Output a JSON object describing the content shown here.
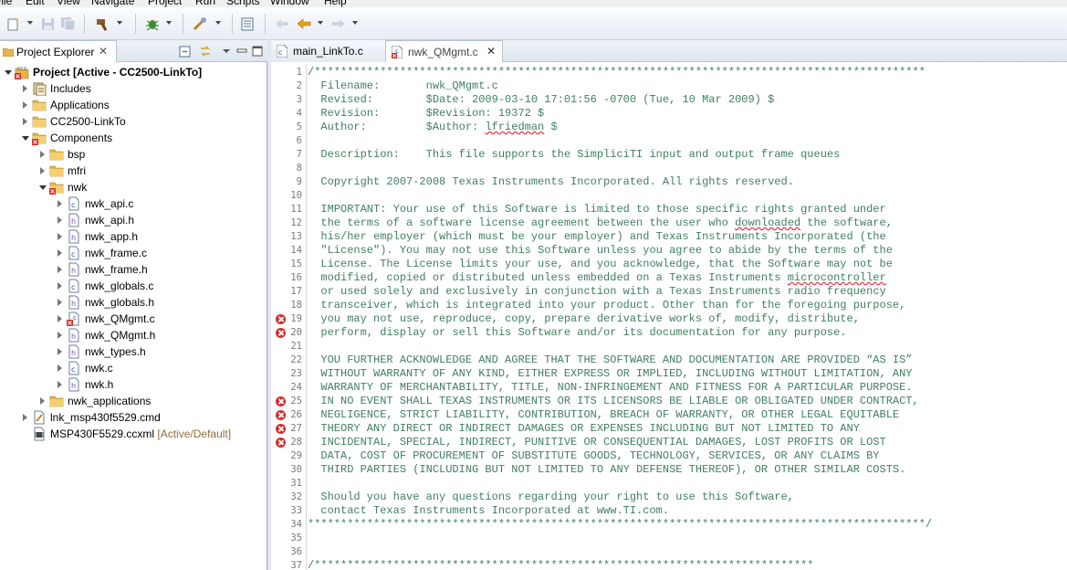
{
  "menubar": {
    "items": [
      "File",
      "Edit",
      "View",
      "Navigate",
      "Project",
      "Run",
      "Scripts",
      "Window",
      "Help"
    ]
  },
  "toolbar": {
    "buttons": [
      {
        "name": "new-icon"
      },
      {
        "name": "save-icon"
      },
      {
        "name": "save-all-icon"
      },
      {
        "name": "build-icon"
      },
      {
        "name": "debug-icon"
      },
      {
        "name": "tools-icon"
      },
      {
        "name": "view-icon"
      },
      {
        "name": "back-icon"
      },
      {
        "name": "forward-icon"
      }
    ]
  },
  "explorer": {
    "tab_label": "Project Explorer",
    "close_glyph": "✕",
    "items": [
      {
        "label": "Project  [Active - CC2500-LinkTo]",
        "icon": "project-icon",
        "depth": 0,
        "state": "open",
        "bold": true
      },
      {
        "label": "Includes",
        "icon": "includes-icon",
        "depth": 1,
        "state": "closed"
      },
      {
        "label": "Applications",
        "icon": "folder-icon",
        "depth": 1,
        "state": "closed"
      },
      {
        "label": "CC2500-LinkTo",
        "icon": "folder-icon",
        "depth": 1,
        "state": "closed"
      },
      {
        "label": "Components",
        "icon": "folder-error-icon",
        "depth": 1,
        "state": "open"
      },
      {
        "label": "bsp",
        "icon": "folder-icon",
        "depth": 2,
        "state": "closed"
      },
      {
        "label": "mfri",
        "icon": "folder-icon",
        "depth": 2,
        "state": "closed"
      },
      {
        "label": "nwk",
        "icon": "folder-error-icon",
        "depth": 2,
        "state": "open"
      },
      {
        "label": "nwk_api.c",
        "icon": "c-file-icon",
        "depth": 3,
        "state": "closed"
      },
      {
        "label": "nwk_api.h",
        "icon": "h-file-icon",
        "depth": 3,
        "state": "closed"
      },
      {
        "label": "nwk_app.h",
        "icon": "h-file-icon",
        "depth": 3,
        "state": "closed"
      },
      {
        "label": "nwk_frame.c",
        "icon": "c-file-icon",
        "depth": 3,
        "state": "closed"
      },
      {
        "label": "nwk_frame.h",
        "icon": "h-file-icon",
        "depth": 3,
        "state": "closed"
      },
      {
        "label": "nwk_globals.c",
        "icon": "c-file-icon",
        "depth": 3,
        "state": "closed"
      },
      {
        "label": "nwk_globals.h",
        "icon": "h-file-icon",
        "depth": 3,
        "state": "closed"
      },
      {
        "label": "nwk_QMgmt.c",
        "icon": "c-file-error-icon",
        "depth": 3,
        "state": "closed"
      },
      {
        "label": "nwk_QMgmt.h",
        "icon": "h-file-icon",
        "depth": 3,
        "state": "closed"
      },
      {
        "label": "nwk_types.h",
        "icon": "h-file-icon",
        "depth": 3,
        "state": "closed"
      },
      {
        "label": "nwk.c",
        "icon": "c-file-icon",
        "depth": 3,
        "state": "closed"
      },
      {
        "label": "nwk.h",
        "icon": "h-file-icon",
        "depth": 3,
        "state": "closed"
      },
      {
        "label": "nwk_applications",
        "icon": "folder-icon",
        "depth": 2,
        "state": "closed"
      },
      {
        "label": "lnk_msp430f5529.cmd",
        "icon": "cmd-file-icon",
        "depth": 1,
        "state": "closed"
      },
      {
        "label": "MSP430F5529.ccxml",
        "suffix": " [Active/Default]",
        "icon": "ccxml-file-icon",
        "depth": 1,
        "state": "none"
      }
    ]
  },
  "editor": {
    "tabs": [
      {
        "label": "main_LinkTo.c",
        "active": false
      },
      {
        "label": "nwk_QMgmt.c",
        "active": true,
        "close_glyph": "✕"
      }
    ],
    "error_lines": [
      19,
      20,
      25,
      26,
      27,
      28
    ],
    "lines": [
      {
        "n": "1",
        "t": "/*********************************************************************************************"
      },
      {
        "n": "2",
        "t": "  Filename:       nwk_QMgmt.c"
      },
      {
        "n": "3",
        "t": "  Revised:        $Date: 2009-03-10 17:01:56 -0700 (Tue, 10 Mar 2009) $"
      },
      {
        "n": "4",
        "t": "  Revision:       $Revision: 19372 $"
      },
      {
        "n": "5",
        "t": "  Author:         $Author: lfriedman $"
      },
      {
        "n": "6",
        "t": ""
      },
      {
        "n": "7",
        "t": "  Description:    This file supports the SimpliciTI input and output frame queues"
      },
      {
        "n": "8",
        "t": ""
      },
      {
        "n": "9",
        "t": "  Copyright 2007-2008 Texas Instruments Incorporated. All rights reserved."
      },
      {
        "n": "10",
        "t": ""
      },
      {
        "n": "11",
        "t": "  IMPORTANT: Your use of this Software is limited to those specific rights granted under"
      },
      {
        "n": "12",
        "t": "  the terms of a software license agreement between the user who downloaded the software,"
      },
      {
        "n": "13",
        "t": "  his/her employer (which must be your employer) and Texas Instruments Incorporated (the"
      },
      {
        "n": "14",
        "t": "  \"License\"). You may not use this Software unless you agree to abide by the terms of the"
      },
      {
        "n": "15",
        "t": "  License. The License limits your use, and you acknowledge, that the Software may not be"
      },
      {
        "n": "16",
        "t": "  modified, copied or distributed unless embedded on a Texas Instruments microcontroller"
      },
      {
        "n": "17",
        "t": "  or used solely and exclusively in conjunction with a Texas Instruments radio frequency"
      },
      {
        "n": "18",
        "t": "  transceiver, which is integrated into your product. Other than for the foregoing purpose,"
      },
      {
        "n": "19",
        "t": "  you may not use, reproduce, copy, prepare derivative works of, modify, distribute,"
      },
      {
        "n": "20",
        "t": "  perform, display or sell this Software and/or its documentation for any purpose."
      },
      {
        "n": "21",
        "t": ""
      },
      {
        "n": "22",
        "t": "  YOU FURTHER ACKNOWLEDGE AND AGREE THAT THE SOFTWARE AND DOCUMENTATION ARE PROVIDED “AS IS”"
      },
      {
        "n": "23",
        "t": "  WITHOUT WARRANTY OF ANY KIND, EITHER EXPRESS OR IMPLIED, INCLUDING WITHOUT LIMITATION, ANY"
      },
      {
        "n": "24",
        "t": "  WARRANTY OF MERCHANTABILITY, TITLE, NON-INFRINGEMENT AND FITNESS FOR A PARTICULAR PURPOSE."
      },
      {
        "n": "25",
        "t": "  IN NO EVENT SHALL TEXAS INSTRUMENTS OR ITS LICENSORS BE LIABLE OR OBLIGATED UNDER CONTRACT,"
      },
      {
        "n": "26",
        "t": "  NEGLIGENCE, STRICT LIABILITY, CONTRIBUTION, BREACH OF WARRANTY, OR OTHER LEGAL EQUITABLE"
      },
      {
        "n": "27",
        "t": "  THEORY ANY DIRECT OR INDIRECT DAMAGES OR EXPENSES INCLUDING BUT NOT LIMITED TO ANY"
      },
      {
        "n": "28",
        "t": "  INCIDENTAL, SPECIAL, INDIRECT, PUNITIVE OR CONSEQUENTIAL DAMAGES, LOST PROFITS OR LOST"
      },
      {
        "n": "29",
        "t": "  DATA, COST OF PROCUREMENT OF SUBSTITUTE GOODS, TECHNOLOGY, SERVICES, OR ANY CLAIMS BY"
      },
      {
        "n": "30",
        "t": "  THIRD PARTIES (INCLUDING BUT NOT LIMITED TO ANY DEFENSE THEREOF), OR OTHER SIMILAR COSTS."
      },
      {
        "n": "31",
        "t": ""
      },
      {
        "n": "32",
        "t": "  Should you have any questions regarding your right to use this Software,"
      },
      {
        "n": "33",
        "t": "  contact Texas Instruments Incorporated at www.TI.com."
      },
      {
        "n": "34",
        "t": "**********************************************************************************************/"
      },
      {
        "n": "35",
        "t": ""
      },
      {
        "n": "36",
        "t": ""
      },
      {
        "n": "37",
        "t": "/****************************************************************************"
      }
    ]
  }
}
